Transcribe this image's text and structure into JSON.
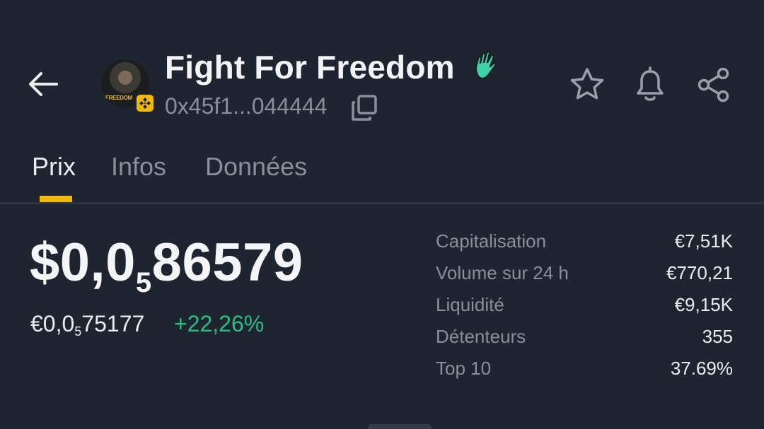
{
  "header": {
    "back_icon": "arrow-left-icon",
    "token_name": "Fight For Freedom",
    "avatar_poster_text": "FREEDOM",
    "chain_badge_icon": "bnb-chain-icon",
    "name_emoji_icon": "waving-hand-icon",
    "address": "0x45f1...044444",
    "copy_icon": "copy-icon",
    "actions": [
      "star-icon",
      "bell-icon",
      "share-icon"
    ]
  },
  "tabs": [
    {
      "label": "Prix",
      "active": true
    },
    {
      "label": "Infos",
      "active": false
    },
    {
      "label": "Données",
      "active": false
    }
  ],
  "price": {
    "usd_prefix": "$0,0",
    "usd_zero_count": "5",
    "usd_digits": "86579",
    "eur_prefix": "€0,0",
    "eur_zero_count": "5",
    "eur_digits": "75177",
    "change": "+22,26%"
  },
  "stats": [
    {
      "label": "Capitalisation",
      "value": "€7,51K"
    },
    {
      "label": "Volume sur 24 h",
      "value": "€770,21"
    },
    {
      "label": "Liquidité",
      "value": "€9,15K"
    },
    {
      "label": "Détenteurs",
      "value": "355"
    },
    {
      "label": "Top 10",
      "value": "37.69%"
    }
  ],
  "colors": {
    "background": "#1f2530",
    "accent": "#f0b90b",
    "positive": "#2ebd85",
    "muted_text": "#8a8f99"
  }
}
